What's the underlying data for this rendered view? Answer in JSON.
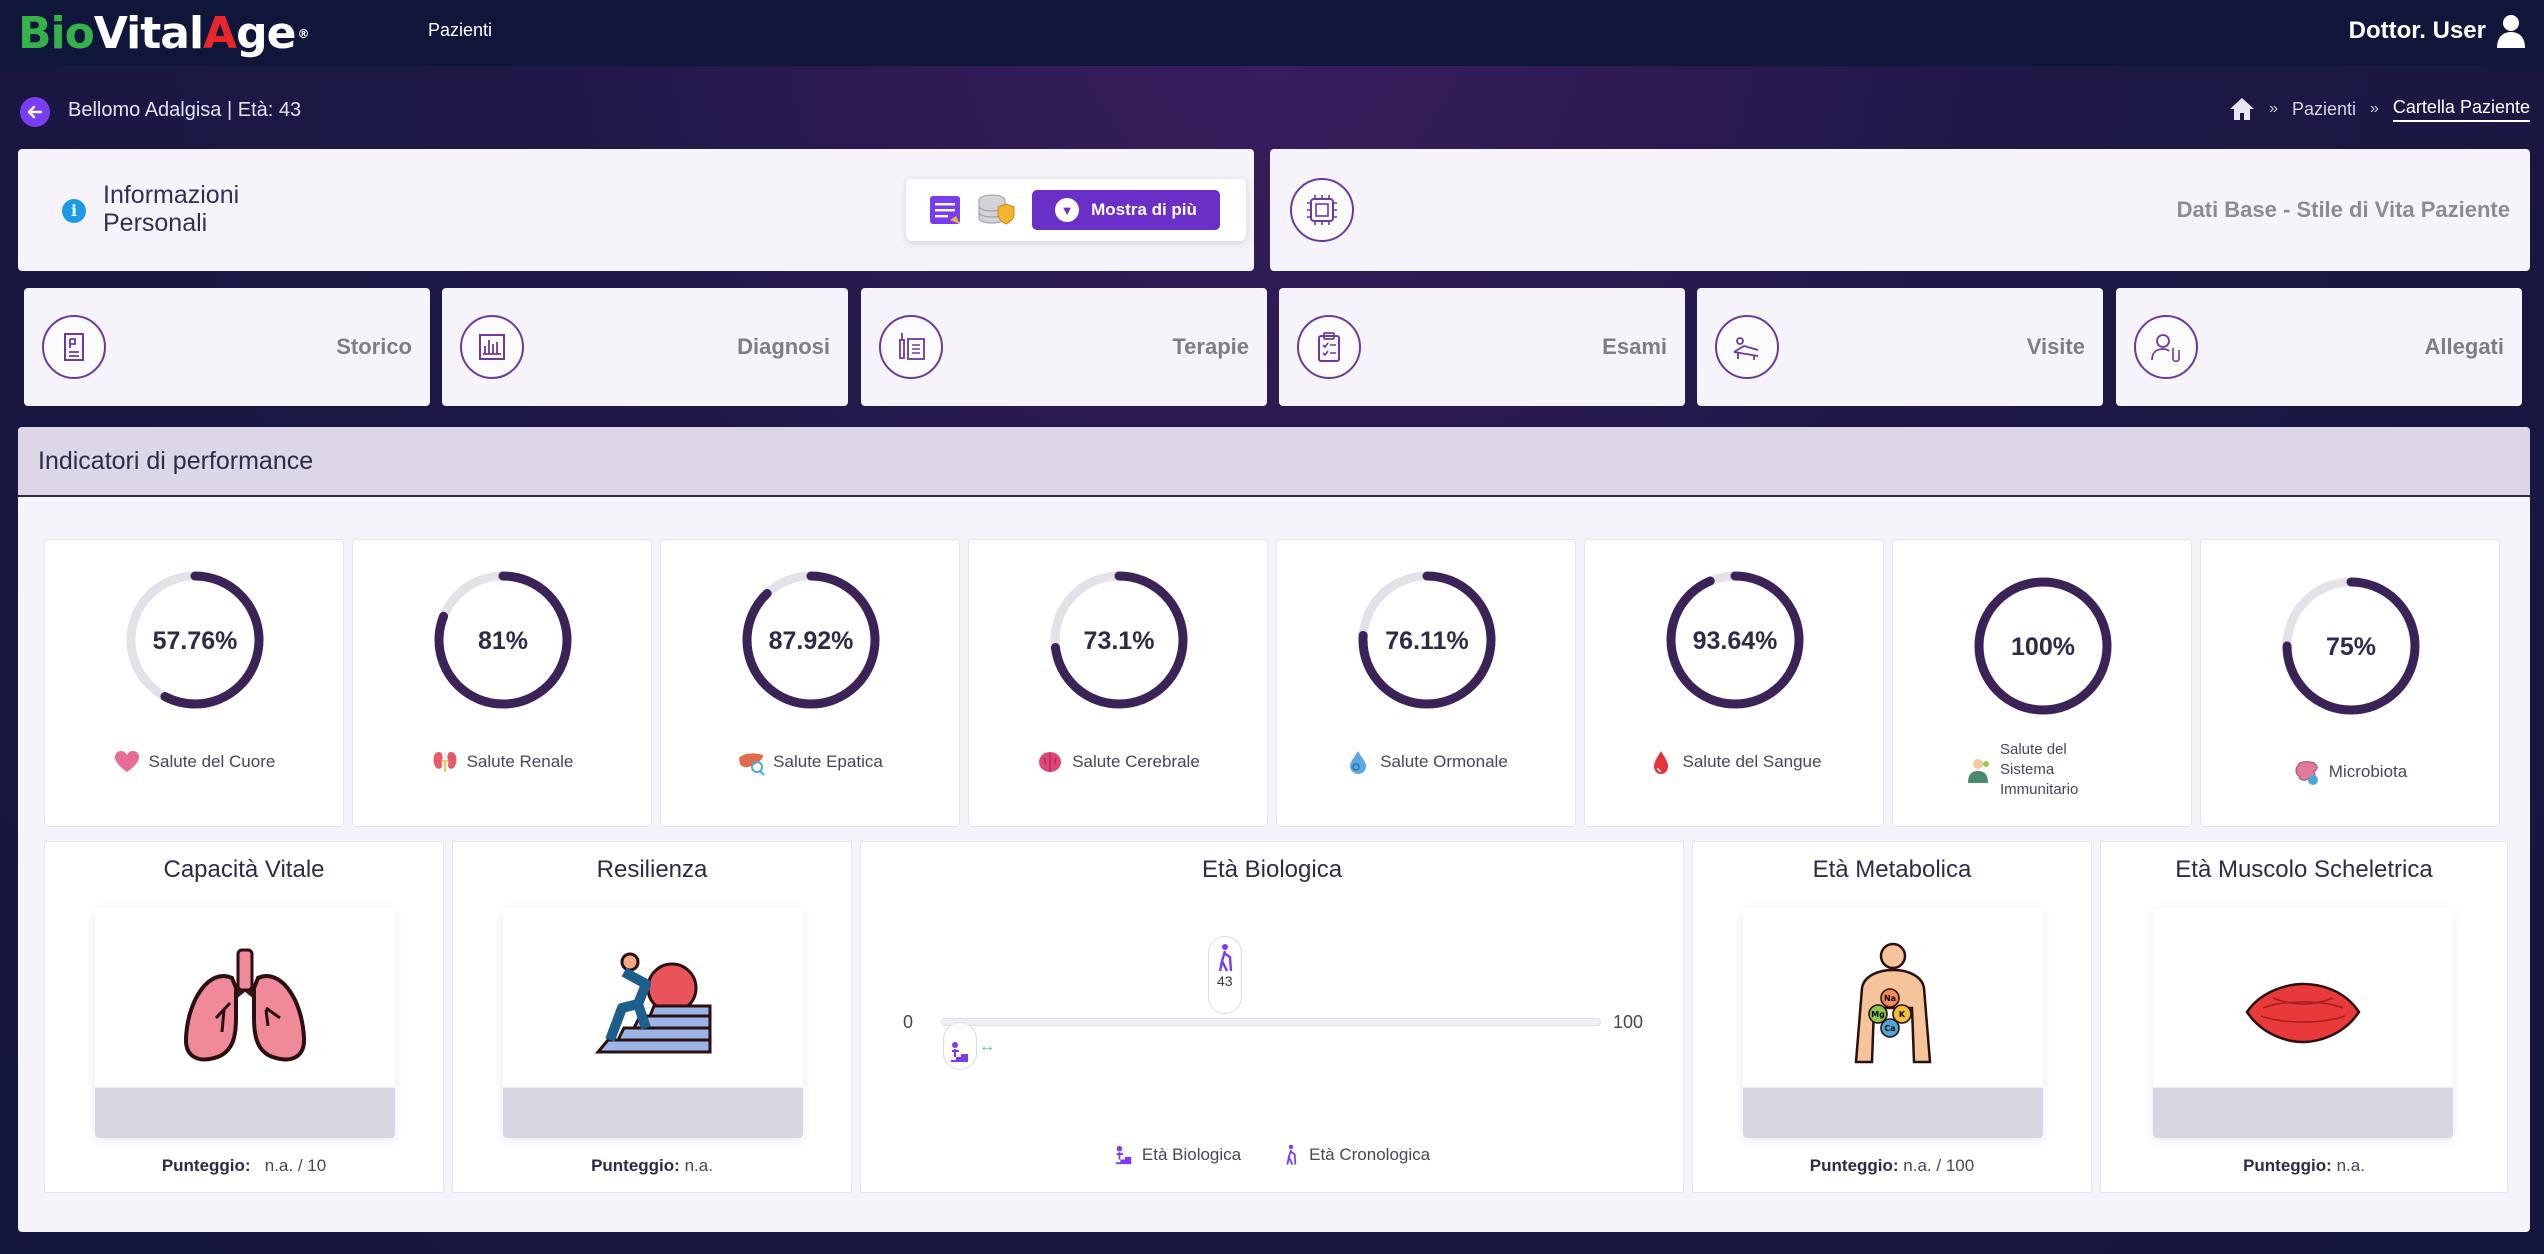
{
  "app": {
    "logo": {
      "bio": "Bio",
      "vital": "Vital",
      "a": "A",
      "ge": "ge",
      "reg": "®"
    },
    "nav": {
      "pazienti": "Pazienti"
    },
    "user": {
      "name": "Dottor. User"
    }
  },
  "subheader": {
    "patient": "Bellomo Adalgisa | Età: 43",
    "breadcrumb": [
      "Pazienti",
      "Cartella Paziente"
    ],
    "separator": "»"
  },
  "personal_info": {
    "title": "Informazioni Personali",
    "show_more": "Mostra di più"
  },
  "dati_base": {
    "label": "Dati Base - Stile di Vita Paziente"
  },
  "nav_cards": [
    {
      "label": "Storico",
      "icon": "history-document-icon"
    },
    {
      "label": "Diagnosi",
      "icon": "diagnosis-chart-icon"
    },
    {
      "label": "Terapie",
      "icon": "therapy-syringe-icon"
    },
    {
      "label": "Esami",
      "icon": "exam-clipboard-icon"
    },
    {
      "label": "Visite",
      "icon": "visit-bed-icon"
    },
    {
      "label": "Allegati",
      "icon": "attachment-user-icon"
    }
  ],
  "performance": {
    "title": "Indicatori di performance",
    "gauges": [
      {
        "value": "57.76%",
        "pct": 57.76,
        "label": "Salute del Cuore",
        "icon": "heart-icon"
      },
      {
        "value": "81%",
        "pct": 81,
        "label": "Salute Renale",
        "icon": "kidney-icon"
      },
      {
        "value": "87.92%",
        "pct": 87.92,
        "label": "Salute Epatica",
        "icon": "liver-icon"
      },
      {
        "value": "73.1%",
        "pct": 73.1,
        "label": "Salute Cerebrale",
        "icon": "brain-icon"
      },
      {
        "value": "76.11%",
        "pct": 76.11,
        "label": "Salute Ormonale",
        "icon": "hormone-drop-icon"
      },
      {
        "value": "93.64%",
        "pct": 93.64,
        "label": "Salute del Sangue",
        "icon": "blood-drop-icon"
      },
      {
        "value": "100%",
        "pct": 100,
        "label": "Salute del Sistema Immunitario",
        "icon": "immune-system-icon"
      },
      {
        "value": "75%",
        "pct": 75,
        "label": "Microbiota",
        "icon": "microbiota-icon"
      }
    ],
    "capacita": {
      "title": "Capacità Vitale",
      "score_label": "Punteggio:",
      "score_value": "n.a. / 10"
    },
    "resilienza": {
      "title": "Resilienza",
      "score_label": "Punteggio:",
      "score_value": "n.a."
    },
    "eta_biologica": {
      "title": "Età Biologica",
      "min": "0",
      "max": "100",
      "chronological": "43",
      "chronological_pct": 43,
      "legend_bio": "Età Biologica",
      "legend_chrono": "Età Cronologica"
    },
    "metabolica": {
      "title": "Età Metabolica",
      "score_label": "Punteggio:",
      "score_value": "n.a. / 100"
    },
    "muscolo": {
      "title": "Età Muscolo Scheletrica",
      "score_label": "Punteggio:",
      "score_value": "n.a."
    }
  },
  "colors": {
    "accent": "#6a2fc7",
    "gauge_fill": "#3b2357",
    "gauge_track": "#e4e2e8"
  }
}
